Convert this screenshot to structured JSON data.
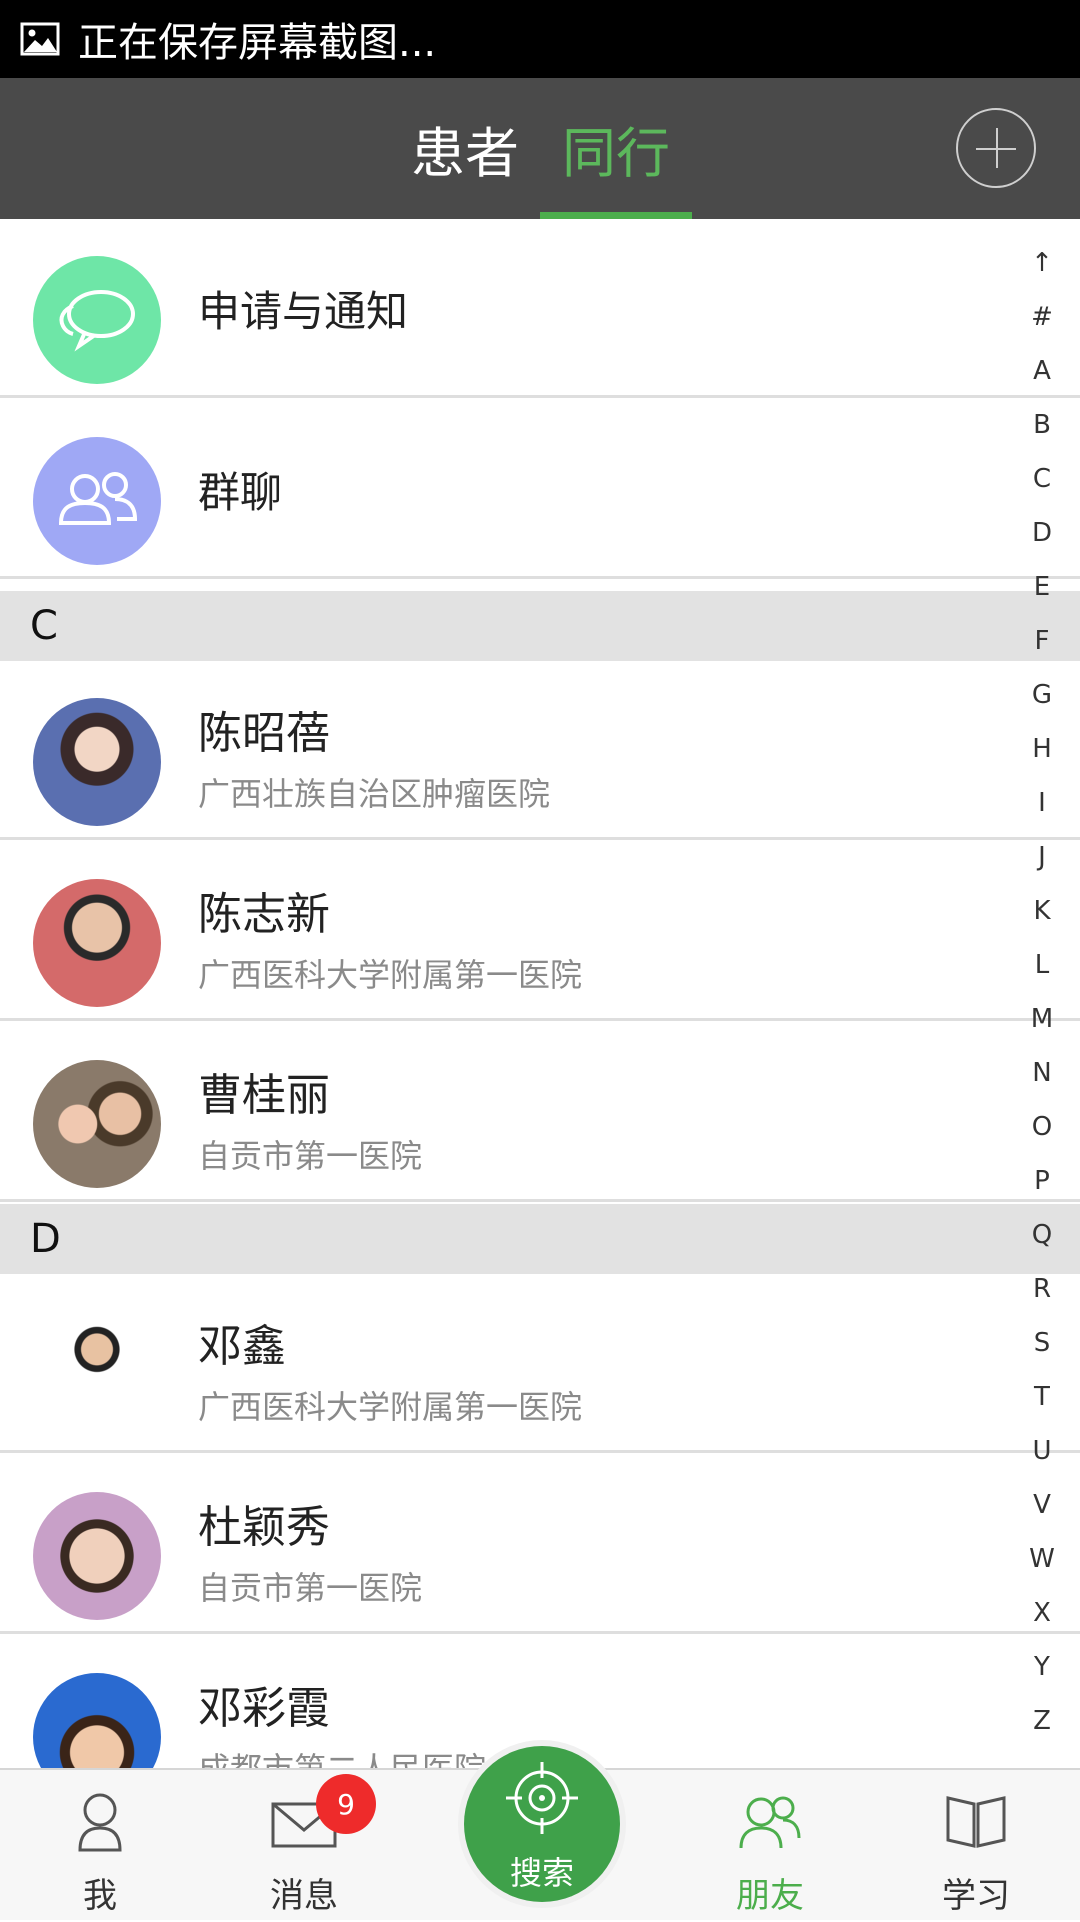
{
  "status_bar": {
    "text": "正在保存屏幕截图...",
    "icon": "image-icon"
  },
  "header": {
    "tabs": [
      {
        "label": "患者",
        "active": false
      },
      {
        "label": "同行",
        "active": true
      }
    ],
    "add_icon": "add-circle-icon",
    "accent_color": "#4cae4c"
  },
  "list": {
    "special": [
      {
        "label": "申请与通知",
        "icon": "chat-bubbles-icon",
        "color": "#6ee6a7"
      },
      {
        "label": "群聊",
        "icon": "group-users-icon",
        "color": "#9fa8f5"
      }
    ],
    "sections": [
      {
        "letter": "C",
        "contacts": [
          {
            "name": "陈昭蓓",
            "org": "广西壮族自治区肿瘤医院"
          },
          {
            "name": "陈志新",
            "org": "广西医科大学附属第一医院"
          },
          {
            "name": "曹桂丽",
            "org": "自贡市第一医院"
          }
        ]
      },
      {
        "letter": "D",
        "contacts": [
          {
            "name": "邓鑫",
            "org": "广西医科大学附属第一医院"
          },
          {
            "name": "杜颖秀",
            "org": "自贡市第一医院"
          },
          {
            "name": "邓彩霞",
            "org": "成都市第二人民医院"
          }
        ]
      }
    ]
  },
  "index_bar": [
    "↑",
    "#",
    "A",
    "B",
    "C",
    "D",
    "E",
    "F",
    "G",
    "H",
    "I",
    "J",
    "K",
    "L",
    "M",
    "N",
    "O",
    "P",
    "Q",
    "R",
    "S",
    "T",
    "U",
    "V",
    "W",
    "X",
    "Y",
    "Z"
  ],
  "bottom_nav": {
    "me": "我",
    "messages": "消息",
    "messages_badge": "9",
    "search": "搜索",
    "friends": "朋友",
    "learn": "学习"
  }
}
